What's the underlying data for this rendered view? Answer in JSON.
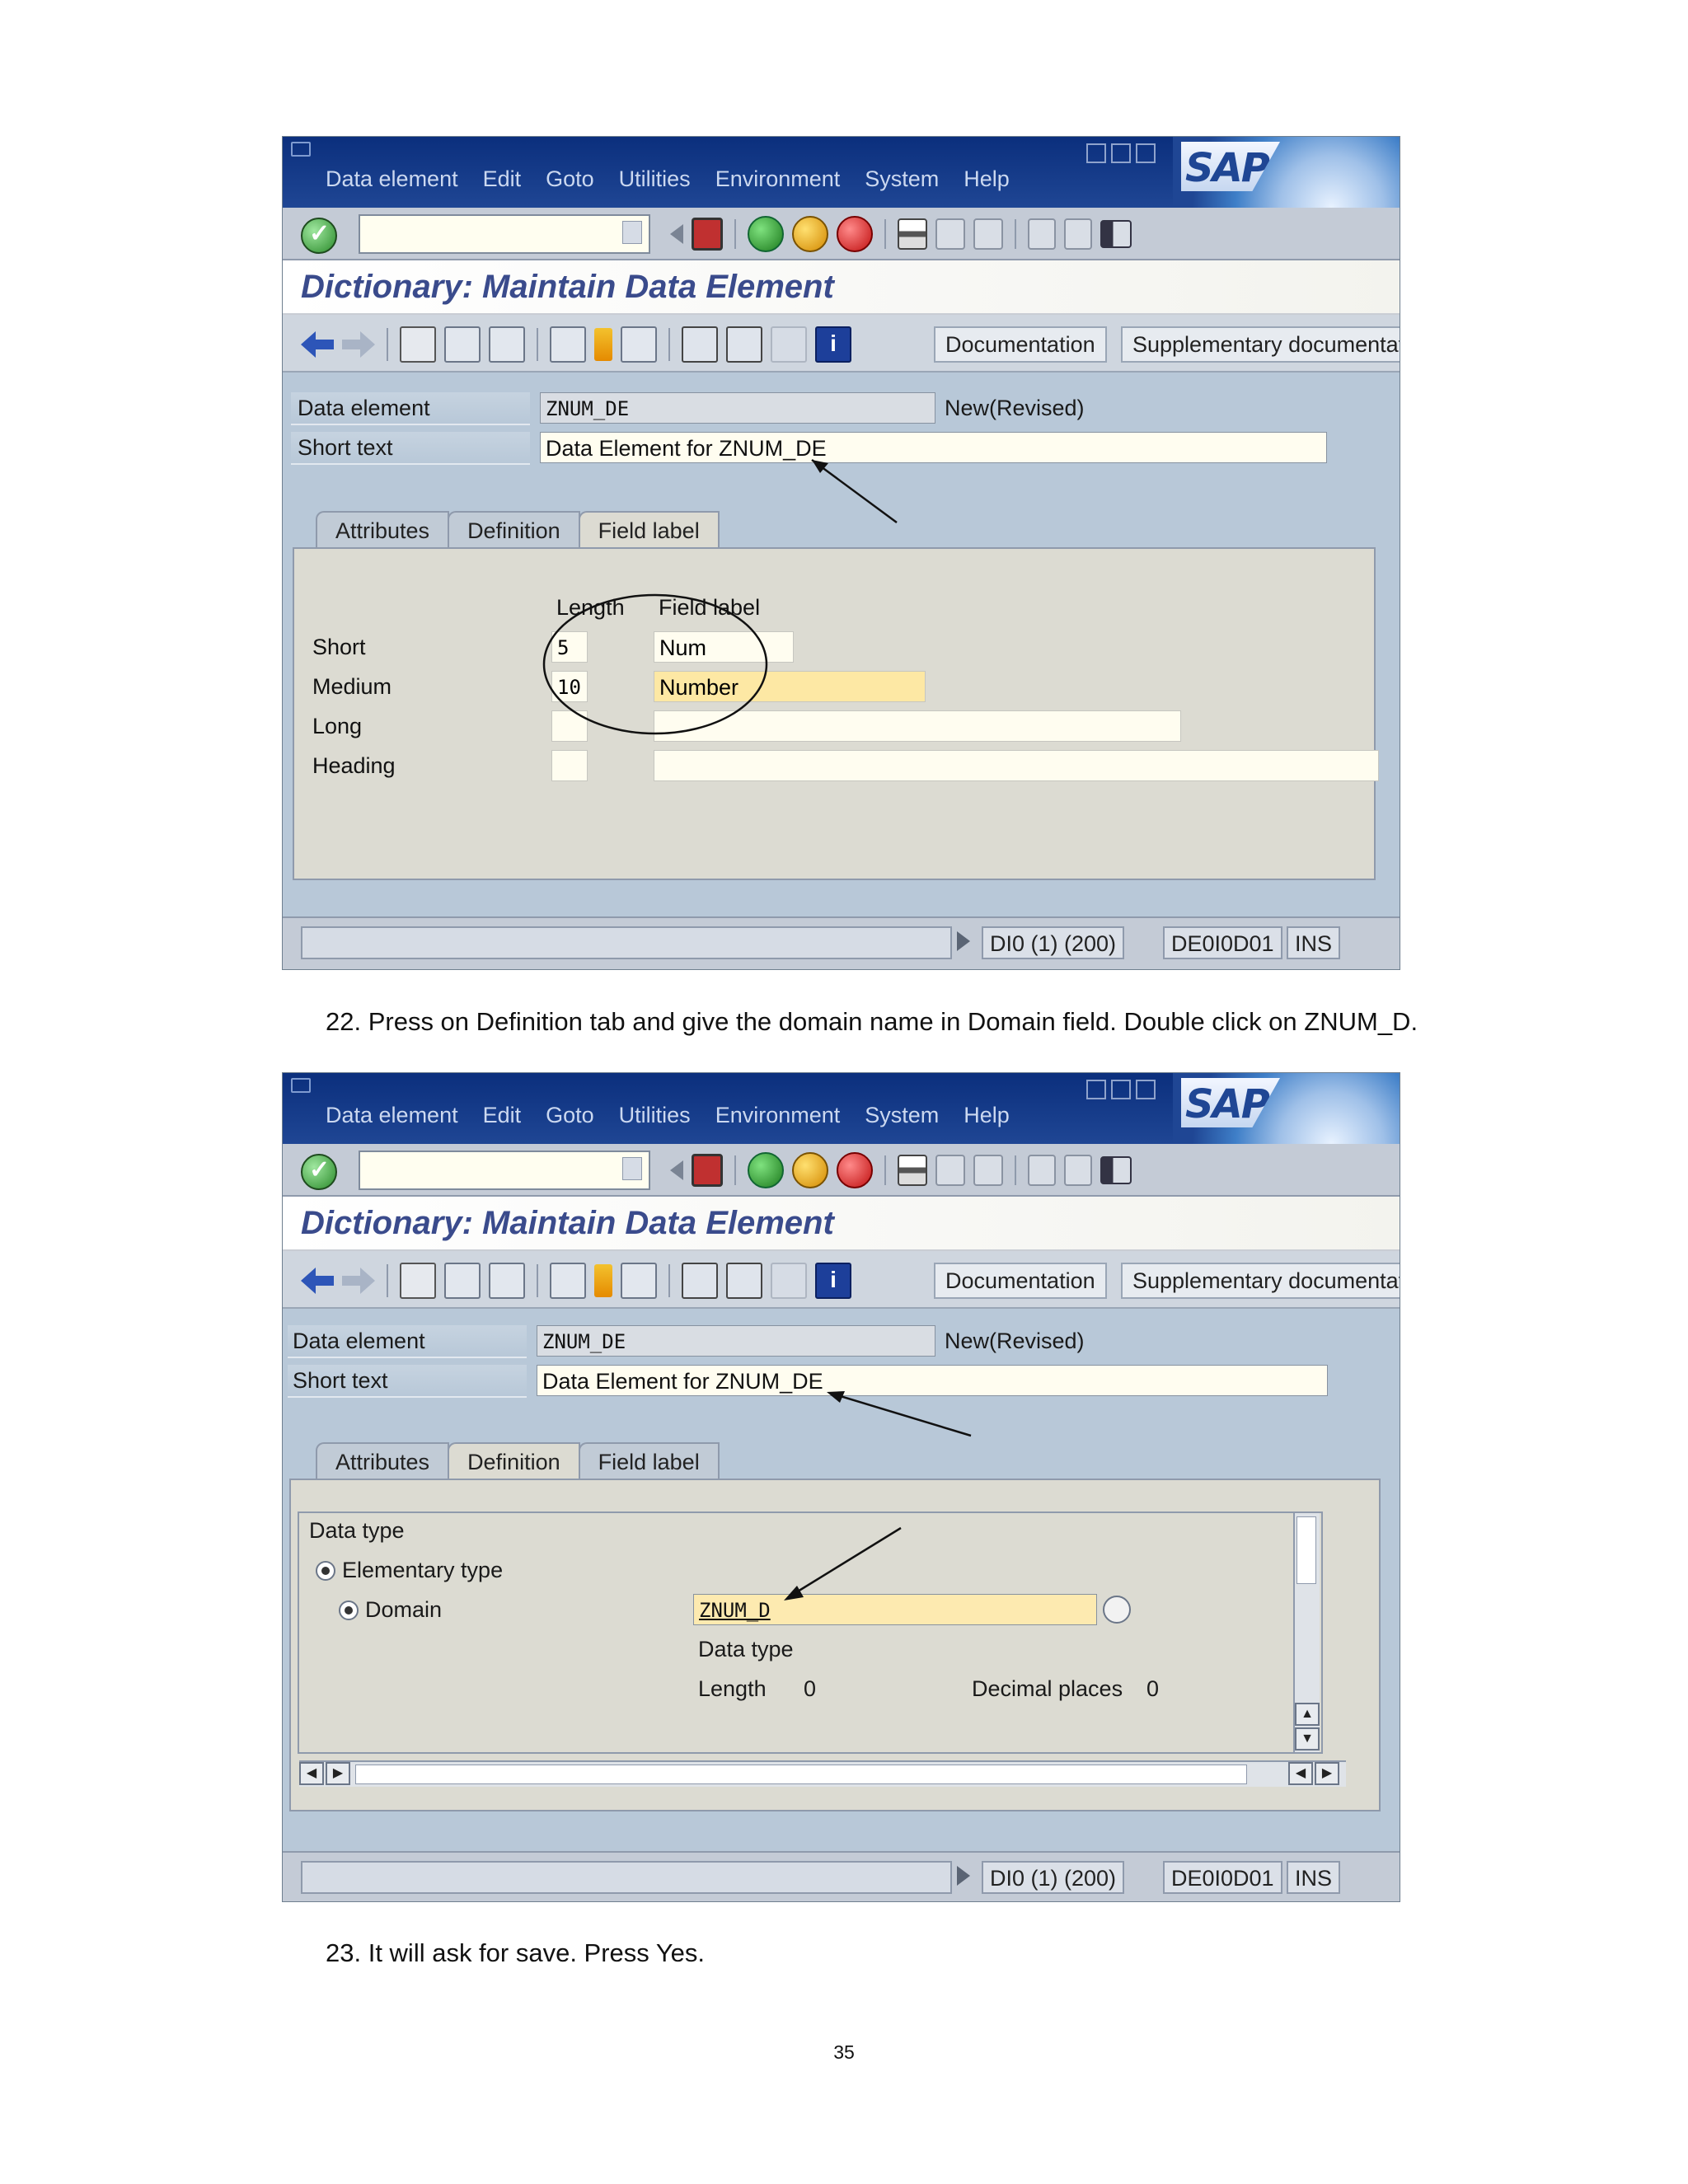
{
  "menu": {
    "items": [
      "Data element",
      "Edit",
      "Goto",
      "Utilities",
      "Environment",
      "System",
      "Help"
    ],
    "brand": "SAP"
  },
  "icons": {
    "standard_toolbar": [
      "enter-icon",
      "save-icon",
      "back-icon",
      "exit-icon",
      "cancel-icon",
      "print-icon",
      "find-icon",
      "find-next-icon",
      "first-page-icon",
      "last-page-icon",
      "create-session-icon"
    ],
    "application_toolbar": [
      "previous-object-icon",
      "next-object-icon",
      "display-change-icon",
      "check-icon",
      "activate-icon",
      "where-used-icon",
      "object-list-icon",
      "navigation-window-icon",
      "hierarchy-icon",
      "print-icon",
      "info-icon"
    ]
  },
  "screen": {
    "title": "Dictionary: Maintain Data Element",
    "buttons": {
      "documentation": "Documentation",
      "supplementary": "Supplementary documentation"
    },
    "header": {
      "data_element_label": "Data element",
      "data_element_value": "ZNUM_DE",
      "status": "New(Revised)",
      "short_text_label": "Short text",
      "short_text_value": "Data Element for ZNUM_DE"
    },
    "tabs": [
      "Attributes",
      "Definition",
      "Field label"
    ],
    "status_bar": {
      "system": "DI0 (1) (200)",
      "server": "DE0I0D01",
      "mode": "INS"
    }
  },
  "screenshot1": {
    "active_tab": "Field label",
    "columns": {
      "length": "Length",
      "field_label": "Field label"
    },
    "rows": [
      {
        "label": "Short",
        "length": "5",
        "text": "Num"
      },
      {
        "label": "Medium",
        "length": "10",
        "text": "Number"
      },
      {
        "label": "Long",
        "length": "",
        "text": ""
      },
      {
        "label": "Heading",
        "length": "",
        "text": ""
      }
    ]
  },
  "screenshot2": {
    "active_tab": "Definition",
    "group_title": "Data type",
    "elementary_type_label": "Elementary type",
    "domain_label": "Domain",
    "domain_value": "ZNUM_D",
    "data_type_label": "Data type",
    "length_label": "Length",
    "length_value": "0",
    "decimal_places_label": "Decimal places",
    "decimal_places_value": "0"
  },
  "instructions": {
    "step22": "22.  Press on Definition tab and give the domain name in Domain field. Double click on ZNUM_D.",
    "step23": "23.  It will ask for save. Press Yes."
  },
  "page_number": "35",
  "colors": {
    "menu_bar": "#1f4694",
    "screen_bg": "#b8c8d8",
    "title_text": "#3a4b8c",
    "input_bg": "#fffdf0",
    "selected_input_bg": "#fde8a4"
  }
}
